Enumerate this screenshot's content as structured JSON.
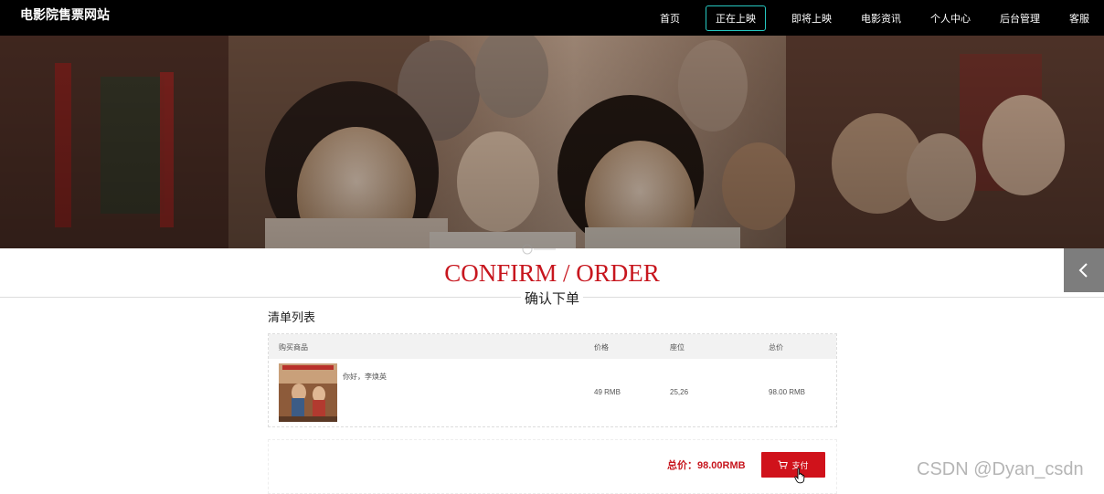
{
  "header": {
    "brand": "电影院售票网站",
    "menu": [
      {
        "label": "首页"
      },
      {
        "label": "正在上映",
        "active": true
      },
      {
        "label": "即将上映"
      },
      {
        "label": "电影资讯"
      },
      {
        "label": "个人中心"
      },
      {
        "label": "后台管理"
      },
      {
        "label": "客服"
      }
    ]
  },
  "page": {
    "title_en": "CONFIRM / ORDER",
    "title_cn": "确认下单",
    "accent_color": "#c7161e"
  },
  "list": {
    "title": "清单列表",
    "columns": {
      "product": "购买商品",
      "price": "价格",
      "seat": "座位",
      "total": "总价"
    },
    "rows": [
      {
        "name": "你好，李焕英",
        "price": "49 RMB",
        "seat": "25,26",
        "total": "98.00 RMB"
      }
    ]
  },
  "summary": {
    "total_label": "总价：98.00RMB",
    "pay_label": "支付"
  },
  "watermark": "CSDN @Dyan_csdn"
}
